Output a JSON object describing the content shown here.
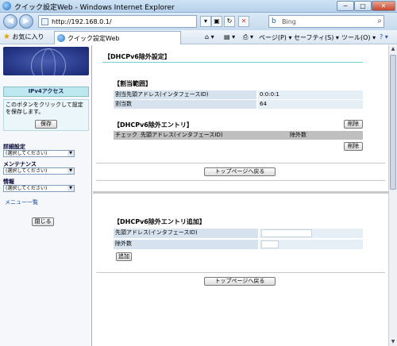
{
  "window": {
    "title": "クイック設定Web - Windows Internet Explorer",
    "controls": {
      "minimize": "─",
      "maximize": "□",
      "close": "✕"
    }
  },
  "addressbar": {
    "url": "http://192.168.0.1/",
    "search_placeholder": "Bing",
    "back": "◀",
    "forward": "▶"
  },
  "commandbar": {
    "favorites": "お気に入り",
    "tab_title": "クイック設定Web",
    "page_menu": "ページ(P)",
    "safety_menu": "セーフティ(S)",
    "tools_menu": "ツール(O)",
    "help_menu": "?"
  },
  "sidebar": {
    "mode_button": "IPv4アクセス",
    "save_desc": "このボタンをクリックして設定を保存します。",
    "save_button": "保存",
    "menus": [
      {
        "label": "詳細設定",
        "selected": "(選択してください)"
      },
      {
        "label": "メンテナンス",
        "selected": "(選択してください)"
      },
      {
        "label": "情報",
        "selected": "(選択してください)"
      }
    ],
    "menu_list_link": "メニュー一覧",
    "close_button": "閉じる"
  },
  "main": {
    "page_title": "【DHCPv6除外設定】",
    "range_section": {
      "title": "【割当範囲】",
      "rows": [
        {
          "label": "割当先頭アドレス(インタフェースID)",
          "value": "0:0:0:1"
        },
        {
          "label": "割当数",
          "value": "64"
        }
      ]
    },
    "exclusion_section": {
      "title": "【DHCPv6除外エントリ】",
      "delete_button": "削除",
      "headers": {
        "check": "チェック",
        "address": "先頭アドレス(インタフェースID)",
        "count": "除外数"
      },
      "delete_button_bottom": "削除"
    },
    "top_button": "トップページへ戻る",
    "add_section": {
      "title": "【DHCPv6除外エントリ追加】",
      "fields": [
        {
          "label": "先頭アドレス(インタフェースID)",
          "value": ""
        },
        {
          "label": "除外数",
          "value": ""
        }
      ],
      "add_button": "追加"
    },
    "top_button_2": "トップページへ戻る"
  }
}
